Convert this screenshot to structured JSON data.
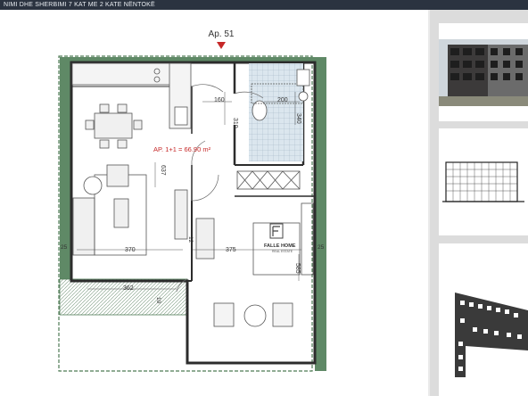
{
  "header": {
    "title": "NIMI DHE SHERBIMI 7 KAT ME 2 KATE NËNTOKË"
  },
  "plan": {
    "apartment_label": "Ap. 51",
    "area_label": "AP. 1+1 = 66.90 m²",
    "watermark_brand": "FALLE HOME",
    "watermark_sub": "REAL ESTATE",
    "dimensions": {
      "d160": "160",
      "d200": "200",
      "d310": "310",
      "d340": "340",
      "d637": "637",
      "d370": "370",
      "d375": "375",
      "d362": "362",
      "d585": "585",
      "d25a": "25",
      "d25b": "25",
      "d12": "12",
      "d10": "10"
    }
  },
  "colors": {
    "header_bg": "#2b3340",
    "wall": "#2c2c2c",
    "facade": "#4e7a55",
    "accent_red": "#c62828",
    "bath_tile": "#dbe6ee",
    "side_panel": "#dcdcdc"
  }
}
